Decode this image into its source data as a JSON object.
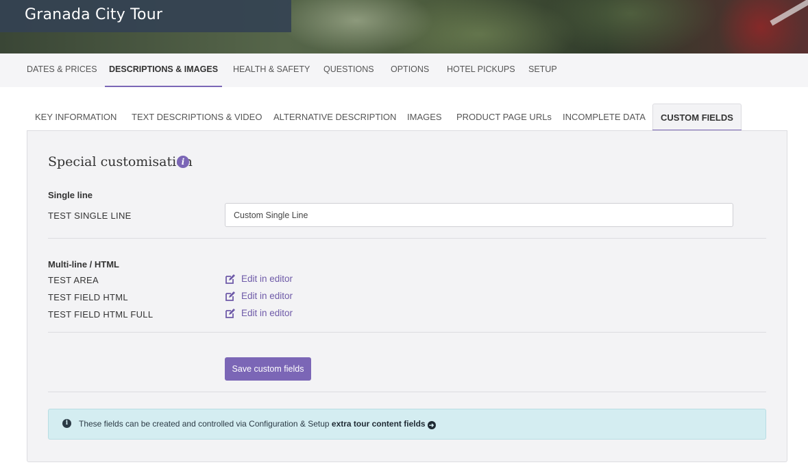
{
  "header": {
    "title": "Granada City Tour"
  },
  "main_nav": {
    "tabs": [
      {
        "label": "DATES & PRICES"
      },
      {
        "label": "DESCRIPTIONS & IMAGES"
      },
      {
        "label": "HEALTH & SAFETY"
      },
      {
        "label": "QUESTIONS"
      },
      {
        "label": "OPTIONS"
      },
      {
        "label": "HOTEL PICKUPS"
      },
      {
        "label": "SETUP"
      }
    ],
    "active": "DESCRIPTIONS & IMAGES"
  },
  "sub_tabs": {
    "tabs": [
      {
        "label": "KEY INFORMATION"
      },
      {
        "label": "TEXT DESCRIPTIONS & VIDEO"
      },
      {
        "label": "ALTERNATIVE DESCRIPTION"
      },
      {
        "label": "IMAGES"
      },
      {
        "label": "PRODUCT PAGE URLs"
      },
      {
        "label": "INCOMPLETE DATA"
      },
      {
        "label": "CUSTOM FIELDS"
      }
    ],
    "active": "CUSTOM FIELDS"
  },
  "panel": {
    "title": "Special customisation",
    "info_icon": "info-icon",
    "single_line": {
      "heading": "Single line",
      "field_label": "TEST SINGLE LINE",
      "field_value": "Custom Single Line"
    },
    "multi_line": {
      "heading": "Multi-line / HTML",
      "fields": [
        {
          "label": "TEST AREA",
          "link": "Edit in editor"
        },
        {
          "label": "TEST FIELD HTML",
          "link": "Edit in editor"
        },
        {
          "label": "TEST FIELD HTML FULL",
          "link": "Edit in editor"
        }
      ]
    },
    "save_label": "Save custom fields",
    "alert": {
      "text": "These fields can be created and controlled via Configuration & Setup ",
      "link": "extra tour content fields"
    }
  },
  "colors": {
    "accent": "#7b66b6",
    "header_box": "#344252",
    "alert_bg": "#d4edf1"
  }
}
